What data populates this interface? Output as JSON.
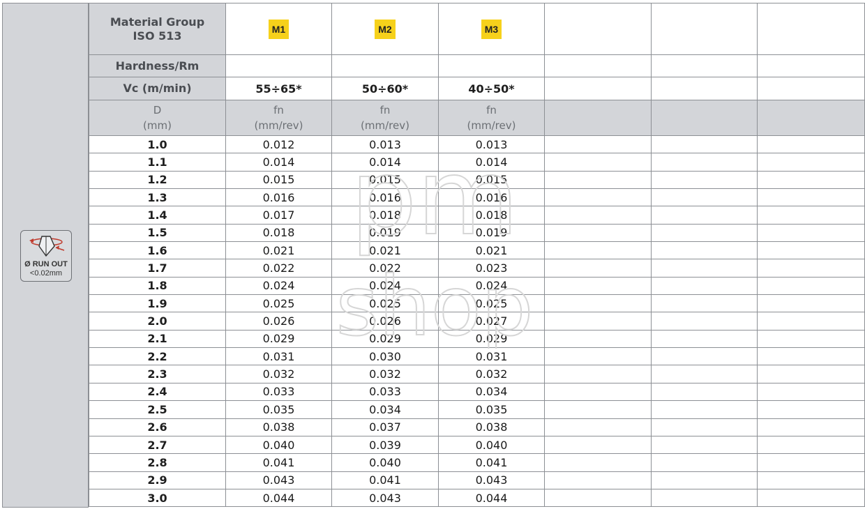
{
  "header": {
    "material_group": "Material Group",
    "iso": "ISO 513",
    "hardness": "Hardness/Rm",
    "vc": "Vc (m/min)",
    "d_label": "D",
    "d_unit": "(mm)",
    "groups": [
      {
        "badge": "M1",
        "vc": "55÷65*",
        "fn": "fn",
        "fn_unit": "(mm/rev)",
        "color": "#f6d11b"
      },
      {
        "badge": "M2",
        "vc": "50÷60*",
        "fn": "fn",
        "fn_unit": "(mm/rev)",
        "color": "#f6d11b"
      },
      {
        "badge": "M3",
        "vc": "40÷50*",
        "fn": "fn",
        "fn_unit": "(mm/rev)",
        "color": "#f6d11b"
      }
    ]
  },
  "side_icon": {
    "name": "run-out-icon",
    "line1": "Ø RUN OUT",
    "line2": "<0.02mm"
  },
  "rows": [
    {
      "d": "1.0",
      "m1": "0.012",
      "m2": "0.013",
      "m3": "0.013"
    },
    {
      "d": "1.1",
      "m1": "0.014",
      "m2": "0.014",
      "m3": "0.014"
    },
    {
      "d": "1.2",
      "m1": "0.015",
      "m2": "0.015",
      "m3": "0.015"
    },
    {
      "d": "1.3",
      "m1": "0.016",
      "m2": "0.016",
      "m3": "0.016"
    },
    {
      "d": "1.4",
      "m1": "0.017",
      "m2": "0.018",
      "m3": "0.018"
    },
    {
      "d": "1.5",
      "m1": "0.018",
      "m2": "0.019",
      "m3": "0.019"
    },
    {
      "d": "1.6",
      "m1": "0.021",
      "m2": "0.021",
      "m3": "0.021"
    },
    {
      "d": "1.7",
      "m1": "0.022",
      "m2": "0.022",
      "m3": "0.023"
    },
    {
      "d": "1.8",
      "m1": "0.024",
      "m2": "0.024",
      "m3": "0.024"
    },
    {
      "d": "1.9",
      "m1": "0.025",
      "m2": "0.025",
      "m3": "0.025"
    },
    {
      "d": "2.0",
      "m1": "0.026",
      "m2": "0.026",
      "m3": "0.027"
    },
    {
      "d": "2.1",
      "m1": "0.029",
      "m2": "0.029",
      "m3": "0.029"
    },
    {
      "d": "2.2",
      "m1": "0.031",
      "m2": "0.030",
      "m3": "0.031"
    },
    {
      "d": "2.3",
      "m1": "0.032",
      "m2": "0.032",
      "m3": "0.032"
    },
    {
      "d": "2.4",
      "m1": "0.033",
      "m2": "0.033",
      "m3": "0.034"
    },
    {
      "d": "2.5",
      "m1": "0.035",
      "m2": "0.034",
      "m3": "0.035"
    },
    {
      "d": "2.6",
      "m1": "0.038",
      "m2": "0.037",
      "m3": "0.038"
    },
    {
      "d": "2.7",
      "m1": "0.040",
      "m2": "0.039",
      "m3": "0.040"
    },
    {
      "d": "2.8",
      "m1": "0.041",
      "m2": "0.040",
      "m3": "0.041"
    },
    {
      "d": "2.9",
      "m1": "0.043",
      "m2": "0.041",
      "m3": "0.043"
    },
    {
      "d": "3.0",
      "m1": "0.044",
      "m2": "0.043",
      "m3": "0.044"
    }
  ],
  "watermark": {
    "line1": "pm",
    "line2": "shop"
  }
}
